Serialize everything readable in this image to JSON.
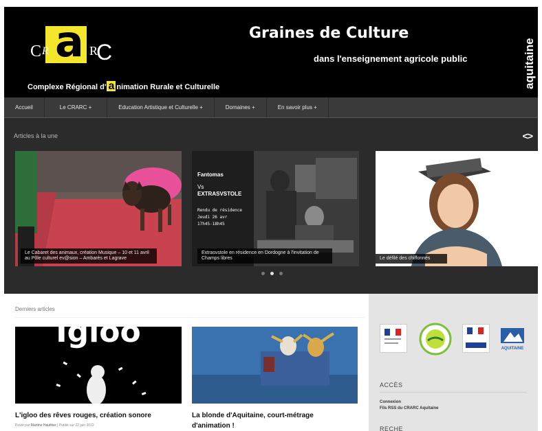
{
  "header": {
    "logo": {
      "c1": "C",
      "r1": "R",
      "a": "a",
      "r2": "R",
      "c2": "C"
    },
    "org_name_prefix": "Complexe Régional d'",
    "org_name_a": "a",
    "org_name_suffix": "nimation Rurale et Culturelle",
    "tagline_title": "Graines de Culture",
    "tagline_sub": "dans l'enseignement agricole public",
    "region_label": "aquitaine"
  },
  "nav": {
    "items": [
      "Accueil",
      "Le CRARC +",
      "Education Artistique et Culturelle +",
      "Domaines +",
      "En savoir plus +"
    ]
  },
  "featured": {
    "title": "Articles à la une",
    "slider_nav": "<>",
    "slides": [
      {
        "caption": "Le Cabaret des animaux, création Musique – 10 et 11 avril au Pôle culturel ev@sion – Ambarès et Lagrave"
      },
      {
        "caption": "Extrasvstole en résidence en Dordogne à l'invitation de Champs libres",
        "poster_title": "Fantomas",
        "poster_vs": "Vs",
        "poster_sub": "EXTRASVSTOLE",
        "poster_lines": [
          "Rendu de résidence",
          "Jeudi 26 avr",
          "17h45-18h45"
        ]
      },
      {
        "caption": "Le défilé des chiffonnés"
      }
    ],
    "active_dot": 1,
    "dot_count": 3
  },
  "latest": {
    "title": "Derniers articles",
    "articles": [
      {
        "title": "L'igloo des rêves rouges, création sonore",
        "meta_prefix": "Posté par ",
        "author": "Martine Hauthier",
        "meta_suffix": " | Publié sur 22 juin 2012",
        "thumb_text": "Igloo"
      },
      {
        "title": "La blonde d'Aquitaine, court-métrage d'animation !"
      }
    ]
  },
  "sidebar": {
    "partners": [
      "ministere-logo",
      "enseignement-agricole-logo",
      "prefecture-logo",
      "region-aquitaine-logo"
    ],
    "partner_aquitaine_label": "AQUITAINE",
    "acces": {
      "heading": "ACCÈS",
      "links": [
        "Connexion",
        "Fils RSS du CRARC Aquitaine"
      ]
    },
    "next_heading": "RECHE"
  },
  "colors": {
    "header_bg": "#000000",
    "logo_yellow": "#f4e62a",
    "nav_bg": "#3a3a3a",
    "featured_bg": "#2b2b2b",
    "sidebar_bg": "#e4e4e4"
  }
}
